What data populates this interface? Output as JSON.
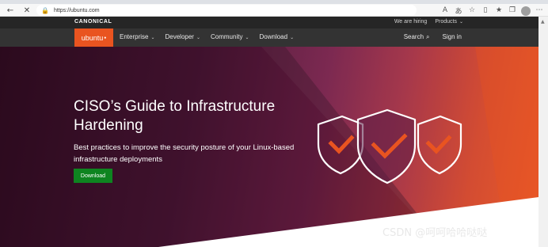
{
  "browser": {
    "url": "https://ubuntu.com",
    "icons": [
      "back-arrow",
      "stop-x",
      "lock",
      "read-aloud",
      "translate",
      "favorite-star",
      "reader",
      "favorites",
      "collections",
      "profile",
      "more"
    ]
  },
  "canonical_bar": {
    "logo": "CANONICAL",
    "links": [
      {
        "label": "We are hiring"
      },
      {
        "label": "Products"
      }
    ]
  },
  "nav": {
    "logo": "ubuntu",
    "items": [
      {
        "label": "Enterprise"
      },
      {
        "label": "Developer"
      },
      {
        "label": "Community"
      },
      {
        "label": "Download"
      }
    ],
    "search": "Search",
    "signin": "Sign in"
  },
  "hero": {
    "title_line1": "CISO’s Guide to Infrastructure",
    "title_line2": "Hardening",
    "subtitle_line1": "Best practices to improve the security posture of your Linux-based",
    "subtitle_line2": "infrastructure deployments",
    "button": "Download"
  },
  "watermark": "CSDN @呵呵哈哈哒哒",
  "colors": {
    "ubuntu_orange": "#e95420",
    "download_green": "#0e8420",
    "nav_dark": "#333333"
  }
}
